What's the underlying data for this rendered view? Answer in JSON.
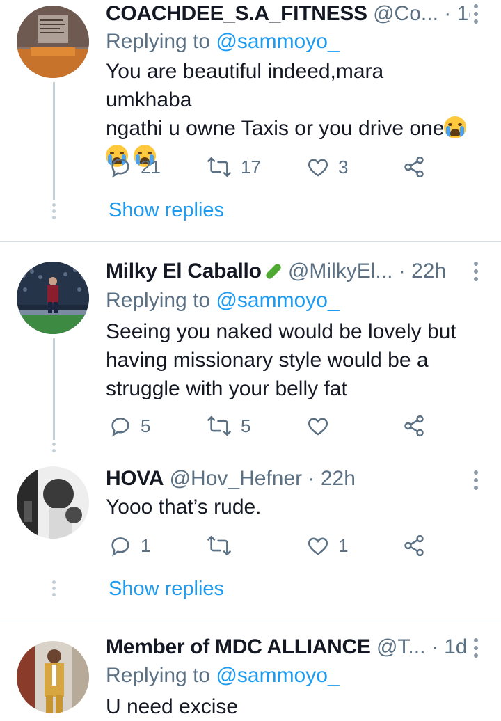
{
  "tweets": [
    {
      "name": "COACHDEE_S.A_FITNESS",
      "handle": "@Co...",
      "dot": "·",
      "time": "1d",
      "replying_label": "Replying to",
      "replying_to": "@sammoyo_",
      "text_lines": [
        "You are beautiful indeed,mara umkhaba",
        "ngathi u owne Taxis or you drive one"
      ],
      "emoji": "loudly-crying-face",
      "replies": "21",
      "retweets": "17",
      "likes": "3",
      "show_replies": "Show replies"
    },
    {
      "name": "Milky El Caballo",
      "name_emoji": "cucumber",
      "handle": "@MilkyEl...",
      "dot": "·",
      "time": "22h",
      "replying_label": "Replying to",
      "replying_to": "@sammoyo_",
      "text_lines": [
        "Seeing you naked would be lovely but",
        "having missionary style would be a",
        "struggle with your belly fat"
      ],
      "replies": "5",
      "retweets": "5",
      "likes": ""
    },
    {
      "name": "HOVA",
      "handle": "@Hov_Hefner",
      "dot": "·",
      "time": "22h",
      "text_lines": [
        "Yooo that’s rude."
      ],
      "replies": "1",
      "retweets": "",
      "likes": "1",
      "show_replies": "Show replies"
    },
    {
      "name": "Member of MDC ALLIANCE",
      "handle": "@T...",
      "dot": "·",
      "time": "1d",
      "replying_label": "Replying to",
      "replying_to": "@sammoyo_",
      "text_lines": [
        "U need excise"
      ]
    }
  ],
  "colors": {
    "link": "#1d9bf0",
    "secondary_text": "#5b7083",
    "thread_line": "#c4cfd6",
    "divider": "#d6dde3"
  },
  "icons": [
    "reply-icon",
    "retweet-icon",
    "like-icon",
    "share-icon",
    "more-options-icon"
  ]
}
